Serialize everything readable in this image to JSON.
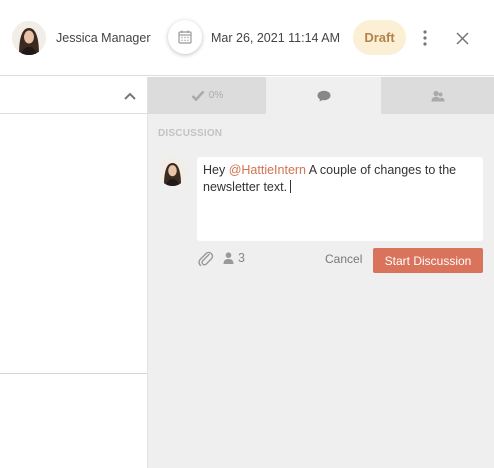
{
  "header": {
    "user_name": "Jessica Manager",
    "date": "Mar 26, 2021 11:14 AM",
    "status_badge": "Draft"
  },
  "tabs": [
    {
      "icon": "checkmark-icon",
      "label": "0%",
      "active": false
    },
    {
      "icon": "comment-icon",
      "label": "",
      "active": true
    },
    {
      "icon": "users-icon",
      "label": "",
      "active": false
    }
  ],
  "discussion": {
    "section_title": "DISCUSSION",
    "comment": {
      "prefix": "Hey ",
      "mention": "@HattieIntern",
      "text": " A couple of changes to the newsletter text."
    },
    "participant_count": "3",
    "cancel_label": "Cancel",
    "start_label": "Start Discussion"
  },
  "colors": {
    "accent": "#d9735c",
    "mention": "#d27351",
    "draft_bg": "#fbefd5",
    "draft_text": "#b5834a",
    "tab_inactive": "#dcdcdc",
    "panel_bg": "#efefef"
  }
}
